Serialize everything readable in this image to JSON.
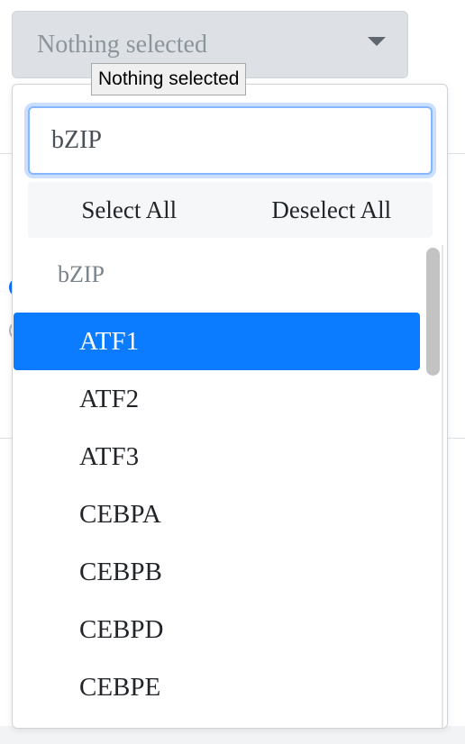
{
  "select": {
    "placeholder": "Nothing selected",
    "tooltip": "Nothing selected"
  },
  "dropdown": {
    "search_value": "bZIP",
    "select_all_label": "Select All",
    "deselect_all_label": "Deselect All",
    "group_label": "bZIP",
    "active_index": 0,
    "options": [
      "ATF1",
      "ATF2",
      "ATF3",
      "CEBPA",
      "CEBPB",
      "CEBPD",
      "CEBPE"
    ]
  },
  "colors": {
    "accent": "#0b7bff",
    "toggle_bg": "#dde1e6",
    "focus_ring": "#86b7fe"
  }
}
